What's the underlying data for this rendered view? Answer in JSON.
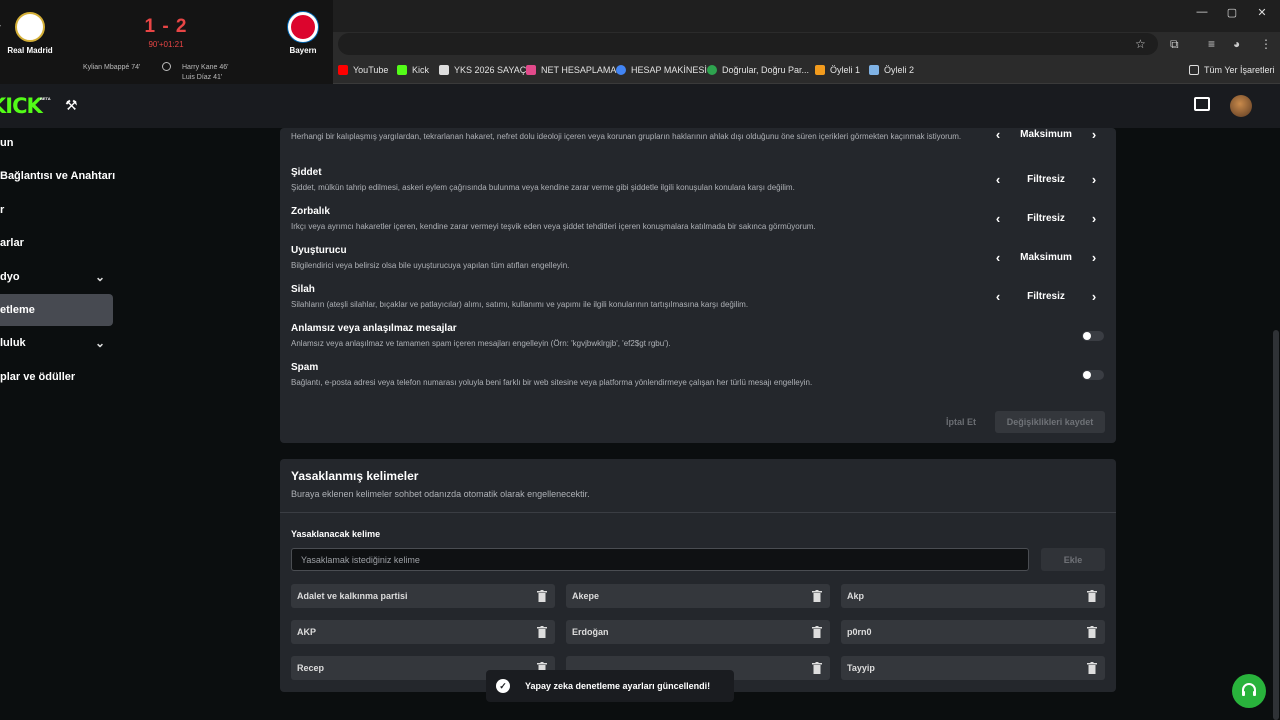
{
  "score_overlay": {
    "home_team": "Real Madrid",
    "away_team": "Bayern",
    "score": "1 - 2",
    "match_time": "90'+01:21",
    "home_scorer": "Kylian Mbappé 74'",
    "away_scorers": [
      "Harry Kane 46'",
      "Luis Díaz 41'"
    ]
  },
  "browser": {
    "bookmarks": [
      {
        "label": "YouTube",
        "icon": "youtube-icon",
        "color": "#ff0000"
      },
      {
        "label": "Kick",
        "icon": "kick-icon",
        "color": "#53fc18"
      },
      {
        "label": "YKS 2026 SAYAÇ",
        "icon": "temple-icon",
        "color": "#dddddd"
      },
      {
        "label": "NET HESAPLAMA",
        "icon": "grid-icon",
        "color": "#e24a8b"
      },
      {
        "label": "HESAP MAKİNESİ",
        "icon": "google-icon",
        "color": "#4285f4"
      },
      {
        "label": "Doğrular, Doğru Par...",
        "icon": "leaf-icon",
        "color": "#2ea44f"
      },
      {
        "label": "Öyleli 1",
        "icon": "warning-icon",
        "color": "#f29b1d"
      },
      {
        "label": "Öyleli 2",
        "icon": "image-icon",
        "color": "#7fb2e5"
      }
    ],
    "all_bookmarks_label": "Tüm Yer İşaretleri"
  },
  "site": {
    "logo": "KICK",
    "logo_badge": "BETA"
  },
  "sidebar": {
    "items": [
      {
        "label": "un",
        "active": false,
        "chevron": false
      },
      {
        "label": "Bağlantısı ve Anahtarı",
        "active": false,
        "chevron": false
      },
      {
        "label": "r",
        "active": false,
        "chevron": false
      },
      {
        "label": "arlar",
        "active": false,
        "chevron": false
      },
      {
        "label": "dyo",
        "active": false,
        "chevron": true
      },
      {
        "label": "etleme",
        "active": true,
        "chevron": false
      },
      {
        "label": "luluk",
        "active": false,
        "chevron": true
      },
      {
        "label": "plar ve ödüller",
        "active": false,
        "chevron": false
      }
    ]
  },
  "moderation": {
    "rows": [
      {
        "title": "",
        "desc": "Herhangi bir kalıplaşmış yargılardan, tekrarlanan hakaret, nefret dolu ideoloji içeren veya korunan grupların haklarının ahlak dışı olduğunu öne süren içerikleri görmekten kaçınmak istiyorum.",
        "value": "Maksimum"
      },
      {
        "title": "Şiddet",
        "desc": "Şiddet, mülkün tahrip edilmesi, askeri eylem çağrısında bulunma veya kendine zarar verme gibi şiddetle ilgili konuşulan konulara karşı değilim.",
        "value": "Filtresiz"
      },
      {
        "title": "Zorbalık",
        "desc": "Irkçı veya ayrımcı hakaretler içeren, kendine zarar vermeyi teşvik eden veya şiddet tehditleri içeren konuşmalara katılmada bir sakınca görmüyorum.",
        "value": "Filtresiz"
      },
      {
        "title": "Uyuşturucu",
        "desc": "Bilgilendirici veya belirsiz olsa bile uyuşturucuya yapılan tüm atıfları engelleyin.",
        "value": "Maksimum"
      },
      {
        "title": "Silah",
        "desc": "Silahların (ateşli silahlar, bıçaklar ve patlayıcılar) alımı, satımı, kullanımı ve yapımı ile ilgili konularının tartışılmasına karşı değilim.",
        "value": "Filtresiz"
      }
    ],
    "toggles": [
      {
        "title": "Anlamsız veya anlaşılmaz mesajlar",
        "desc": "Anlamsız veya anlaşılmaz ve tamamen spam içeren mesajları engelleyin (Örn: 'kgvjbwklrgjb', 'ef2$gt rgbu').",
        "on": false
      },
      {
        "title": "Spam",
        "desc": "Bağlantı, e-posta adresi veya telefon numarası yoluyla beni farklı bir web sitesine veya platforma yönlendirmeye çalışan her türlü mesajı engelleyin.",
        "on": false
      }
    ],
    "cancel_label": "İptal Et",
    "save_label": "Değişiklikleri kaydet"
  },
  "banned_words": {
    "title": "Yasaklanmış kelimeler",
    "subtitle": "Buraya eklenen kelimeler sohbet odanızda otomatik olarak engellenecektir.",
    "input_label": "Yasaklanacak kelime",
    "input_placeholder": "Yasaklamak istediğiniz kelime",
    "add_label": "Ekle",
    "words": [
      "Adalet ve kalkınma partisi",
      "Akepe",
      "Akp",
      "AKP",
      "Erdoğan",
      "p0rn0",
      "Recep",
      "",
      "Tayyip"
    ]
  },
  "toast": {
    "message": "Yapay zeka denetleme ayarları güncellendi!"
  },
  "colors": {
    "brand": "#53fc18",
    "score_red": "#e84545",
    "panel": "#24272c",
    "support": "#29b33c"
  }
}
